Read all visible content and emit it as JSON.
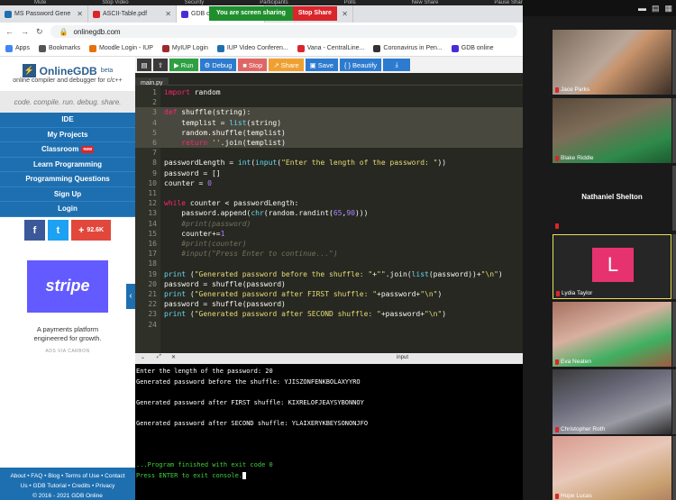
{
  "zoom_bar": [
    "Mute",
    "Stop Video",
    "Security",
    "Participants",
    "Polls",
    "New Share",
    "Pause Share",
    "Annotate",
    "Remote Control",
    "More"
  ],
  "tabs": [
    {
      "title": "MS Password Gene",
      "fav": "#1e6fb0"
    },
    {
      "title": "ASCII-Table.pdf",
      "fav": "#d9262b"
    },
    {
      "title": "GDB online Debugg",
      "fav": "#4a2bd8",
      "active": true
    },
    {
      "title": "(2) overflow",
      "fav": "#d9262b"
    }
  ],
  "share": {
    "status": "You are screen sharing",
    "stop": "Stop Share"
  },
  "address": {
    "url": "onlinegdb.com"
  },
  "bookmarks": [
    {
      "label": "Apps",
      "color": "#4285f4"
    },
    {
      "label": "Bookmarks",
      "color": "#555"
    },
    {
      "label": "Moodle Login - IUP",
      "color": "#e8710a"
    },
    {
      "label": "MyIUP Login",
      "color": "#9c2b2b"
    },
    {
      "label": "IUP Video Conferen...",
      "color": "#1e6fb0"
    },
    {
      "label": "Vana - CentralLine...",
      "color": "#d9262b"
    },
    {
      "label": "Coronavirus in Pen...",
      "color": "#333"
    },
    {
      "label": "GDB online",
      "color": "#4a2bd8"
    }
  ],
  "sidebar": {
    "brand": "OnlineGDB",
    "brand_sup": "beta",
    "subtitle": "online compiler and debugger for c/c++",
    "tagline": "code. compile. run. debug. share.",
    "nav": [
      "IDE",
      "My Projects",
      "Classroom",
      "Learn Programming",
      "Programming Questions",
      "Sign Up",
      "Login"
    ],
    "new_badge": "new",
    "share_count": "92.6K",
    "ad": {
      "brand": "stripe",
      "text1": "A payments platform",
      "text2": "engineered for growth.",
      "via": "ADS VIA CARBON"
    },
    "footer1": "About • FAQ • Blog • Terms of Use • Contact",
    "footer2": "Us • GDB Tutorial • Credits • Privacy",
    "footer3": "© 2016 - 2021 GDB Online"
  },
  "toolbar": {
    "run": "Run",
    "debug": "Debug",
    "stop": "Stop",
    "share": "Share",
    "save": "Save",
    "beautify": "{ } Beautify"
  },
  "file": {
    "name": "main.py"
  },
  "code": [
    "import random",
    "",
    "def shuffle(string):",
    "    templist = list(string)",
    "    random.shuffle(templist)",
    "    return ''.join(templist)",
    "",
    "passwordLength = int(input(\"Enter the length of the password: \"))",
    "password = []",
    "counter = 0",
    "",
    "while counter < passwordLength:",
    "    password.append(chr(random.randint(65,90)))",
    "    #print(password)",
    "    counter+=1",
    "    #print(counter)",
    "    #input(\"Press Enter to continue...\")",
    "",
    "print (\"Generated password before the shuffle: \"+\"\".join(list(password))+\"\\n\")",
    "password = shuffle(password)",
    "print (\"Generated password after FIRST shuffle: \"+password+\"\\n\")",
    "password = shuffle(password)",
    "print (\"Generated password after SECOND shuffle: \"+password+\"\\n\")",
    ""
  ],
  "console": {
    "header": "input",
    "lines": [
      "Enter the length of the password: 20",
      "Generated password before the shuffle: YJISZONFENKBOLAXYYRO",
      "",
      "Generated password after FIRST shuffle: KIXRELOFJEAYSYBONNOY",
      "",
      "Generated password after SECOND shuffle: YLAIXERYKBEYSONONJFO",
      "",
      "",
      "",
      "...Program finished with exit code 0",
      "Press ENTER to exit console."
    ]
  },
  "participants": [
    {
      "name": "Jace Parks"
    },
    {
      "name": "Blake Riddle"
    },
    {
      "name": "Nathaniel Shelton"
    },
    {
      "name": "Lydia Taylor",
      "initial": "L"
    },
    {
      "name": "Eva Neaten"
    },
    {
      "name": "Christopher Roth"
    },
    {
      "name": "Hope Lucas"
    }
  ]
}
